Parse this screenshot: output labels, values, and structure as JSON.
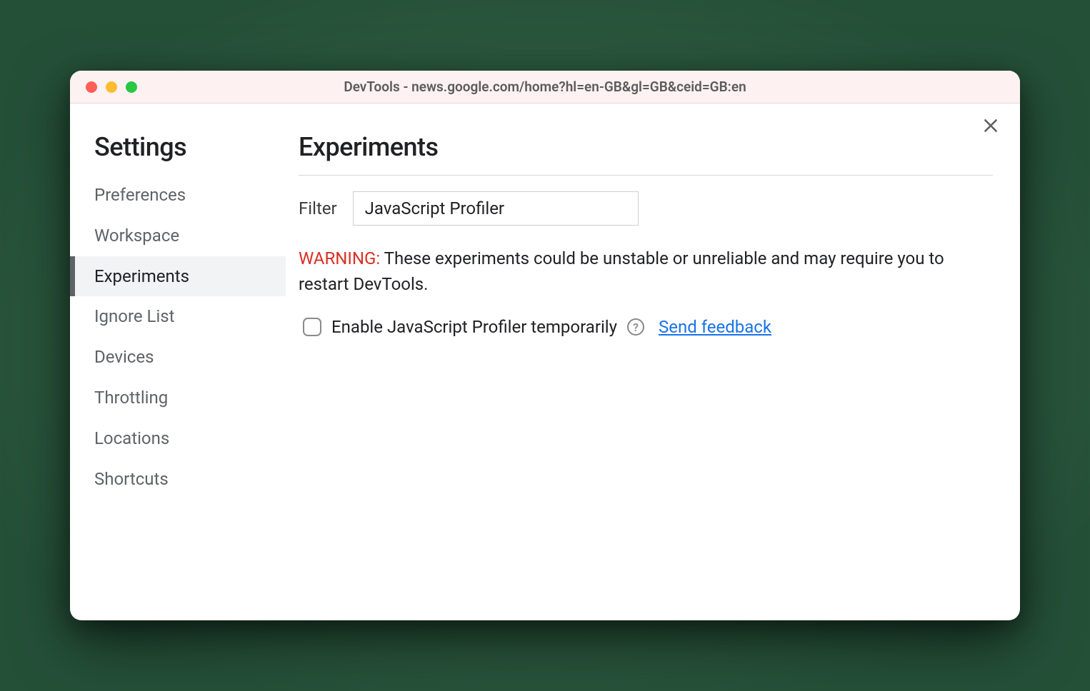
{
  "window": {
    "title": "DevTools - news.google.com/home?hl=en-GB&gl=GB&ceid=GB:en"
  },
  "sidebar": {
    "title": "Settings",
    "items": [
      {
        "label": "Preferences",
        "active": false
      },
      {
        "label": "Workspace",
        "active": false
      },
      {
        "label": "Experiments",
        "active": true
      },
      {
        "label": "Ignore List",
        "active": false
      },
      {
        "label": "Devices",
        "active": false
      },
      {
        "label": "Throttling",
        "active": false
      },
      {
        "label": "Locations",
        "active": false
      },
      {
        "label": "Shortcuts",
        "active": false
      }
    ]
  },
  "main": {
    "title": "Experiments",
    "filter_label": "Filter",
    "filter_value": "JavaScript Profiler",
    "warning_label": "WARNING:",
    "warning_text": " These experiments could be unstable or unreliable and may require you to restart DevTools.",
    "experiment": {
      "checked": false,
      "label": "Enable JavaScript Profiler temporarily",
      "help_glyph": "?",
      "feedback_link": "Send feedback"
    }
  }
}
